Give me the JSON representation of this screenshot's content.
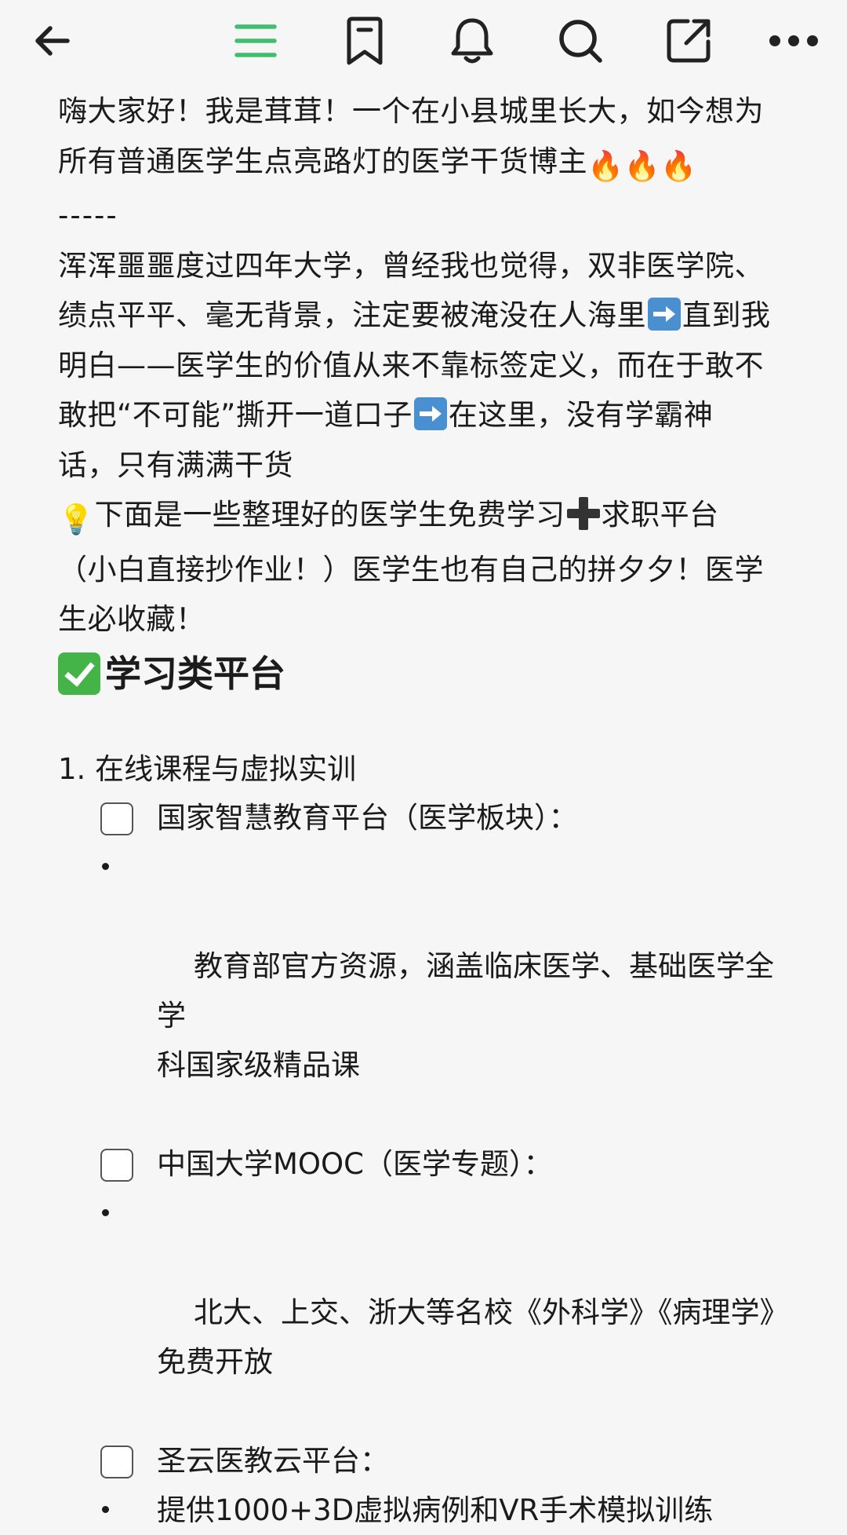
{
  "toolbar": {
    "icons": [
      "back-arrow-icon",
      "menu-icon",
      "bookmark-icon",
      "bell-icon",
      "search-icon",
      "share-icon",
      "more-icon"
    ],
    "accent_color": "#3fbf6e"
  },
  "intro": {
    "line1": "嗨大家好！我是茸茸！一个在小县城里长大，如今想为",
    "line2": "所有普通医学生点亮路灯的医学干货博主",
    "fire_emoji": "🔥🔥🔥",
    "divider": "-----"
  },
  "story": {
    "part1": "浑浑噩噩度过四年大学，曾经我也觉得，双非医学院、\n绩点平平、毫无背景，注定要被淹没在人海里",
    "part2": "直到我\n明白——医学生的价值从来不靠标签定义，而在于敢不\n敢把“不可能”撕开一道口子",
    "part3": "在这里，没有学霸神\n话，只有满满干货"
  },
  "tip": {
    "emoji": "💡",
    "part1": "下面是一些整理好的医学生免费学习",
    "part2": "求职平台\n（小白直接抄作业！）医学生也有自己的拼夕夕！医学\n生必收藏！"
  },
  "heading": {
    "text": "学习类平台",
    "check_color": "#44b449"
  },
  "section": {
    "title": "1. 在线课程与虚拟实训"
  },
  "items": [
    {
      "type": "checkbox",
      "text": "国家智慧教育平台（医学板块）："
    },
    {
      "type": "bullet",
      "text": "教育部官方资源，涵盖临床医学、基础医学全学\n科国家级精品课"
    },
    {
      "type": "checkbox",
      "text": "中国大学MOOC（医学专题）："
    },
    {
      "type": "bullet",
      "text": "北大、上交、浙大等名校《外科学》《病理学》\n免费开放"
    },
    {
      "type": "checkbox",
      "text": "圣云医教云平台："
    },
    {
      "type": "bullet",
      "text": "提供1000+3D虚拟病例和VR手术模拟训练"
    }
  ]
}
